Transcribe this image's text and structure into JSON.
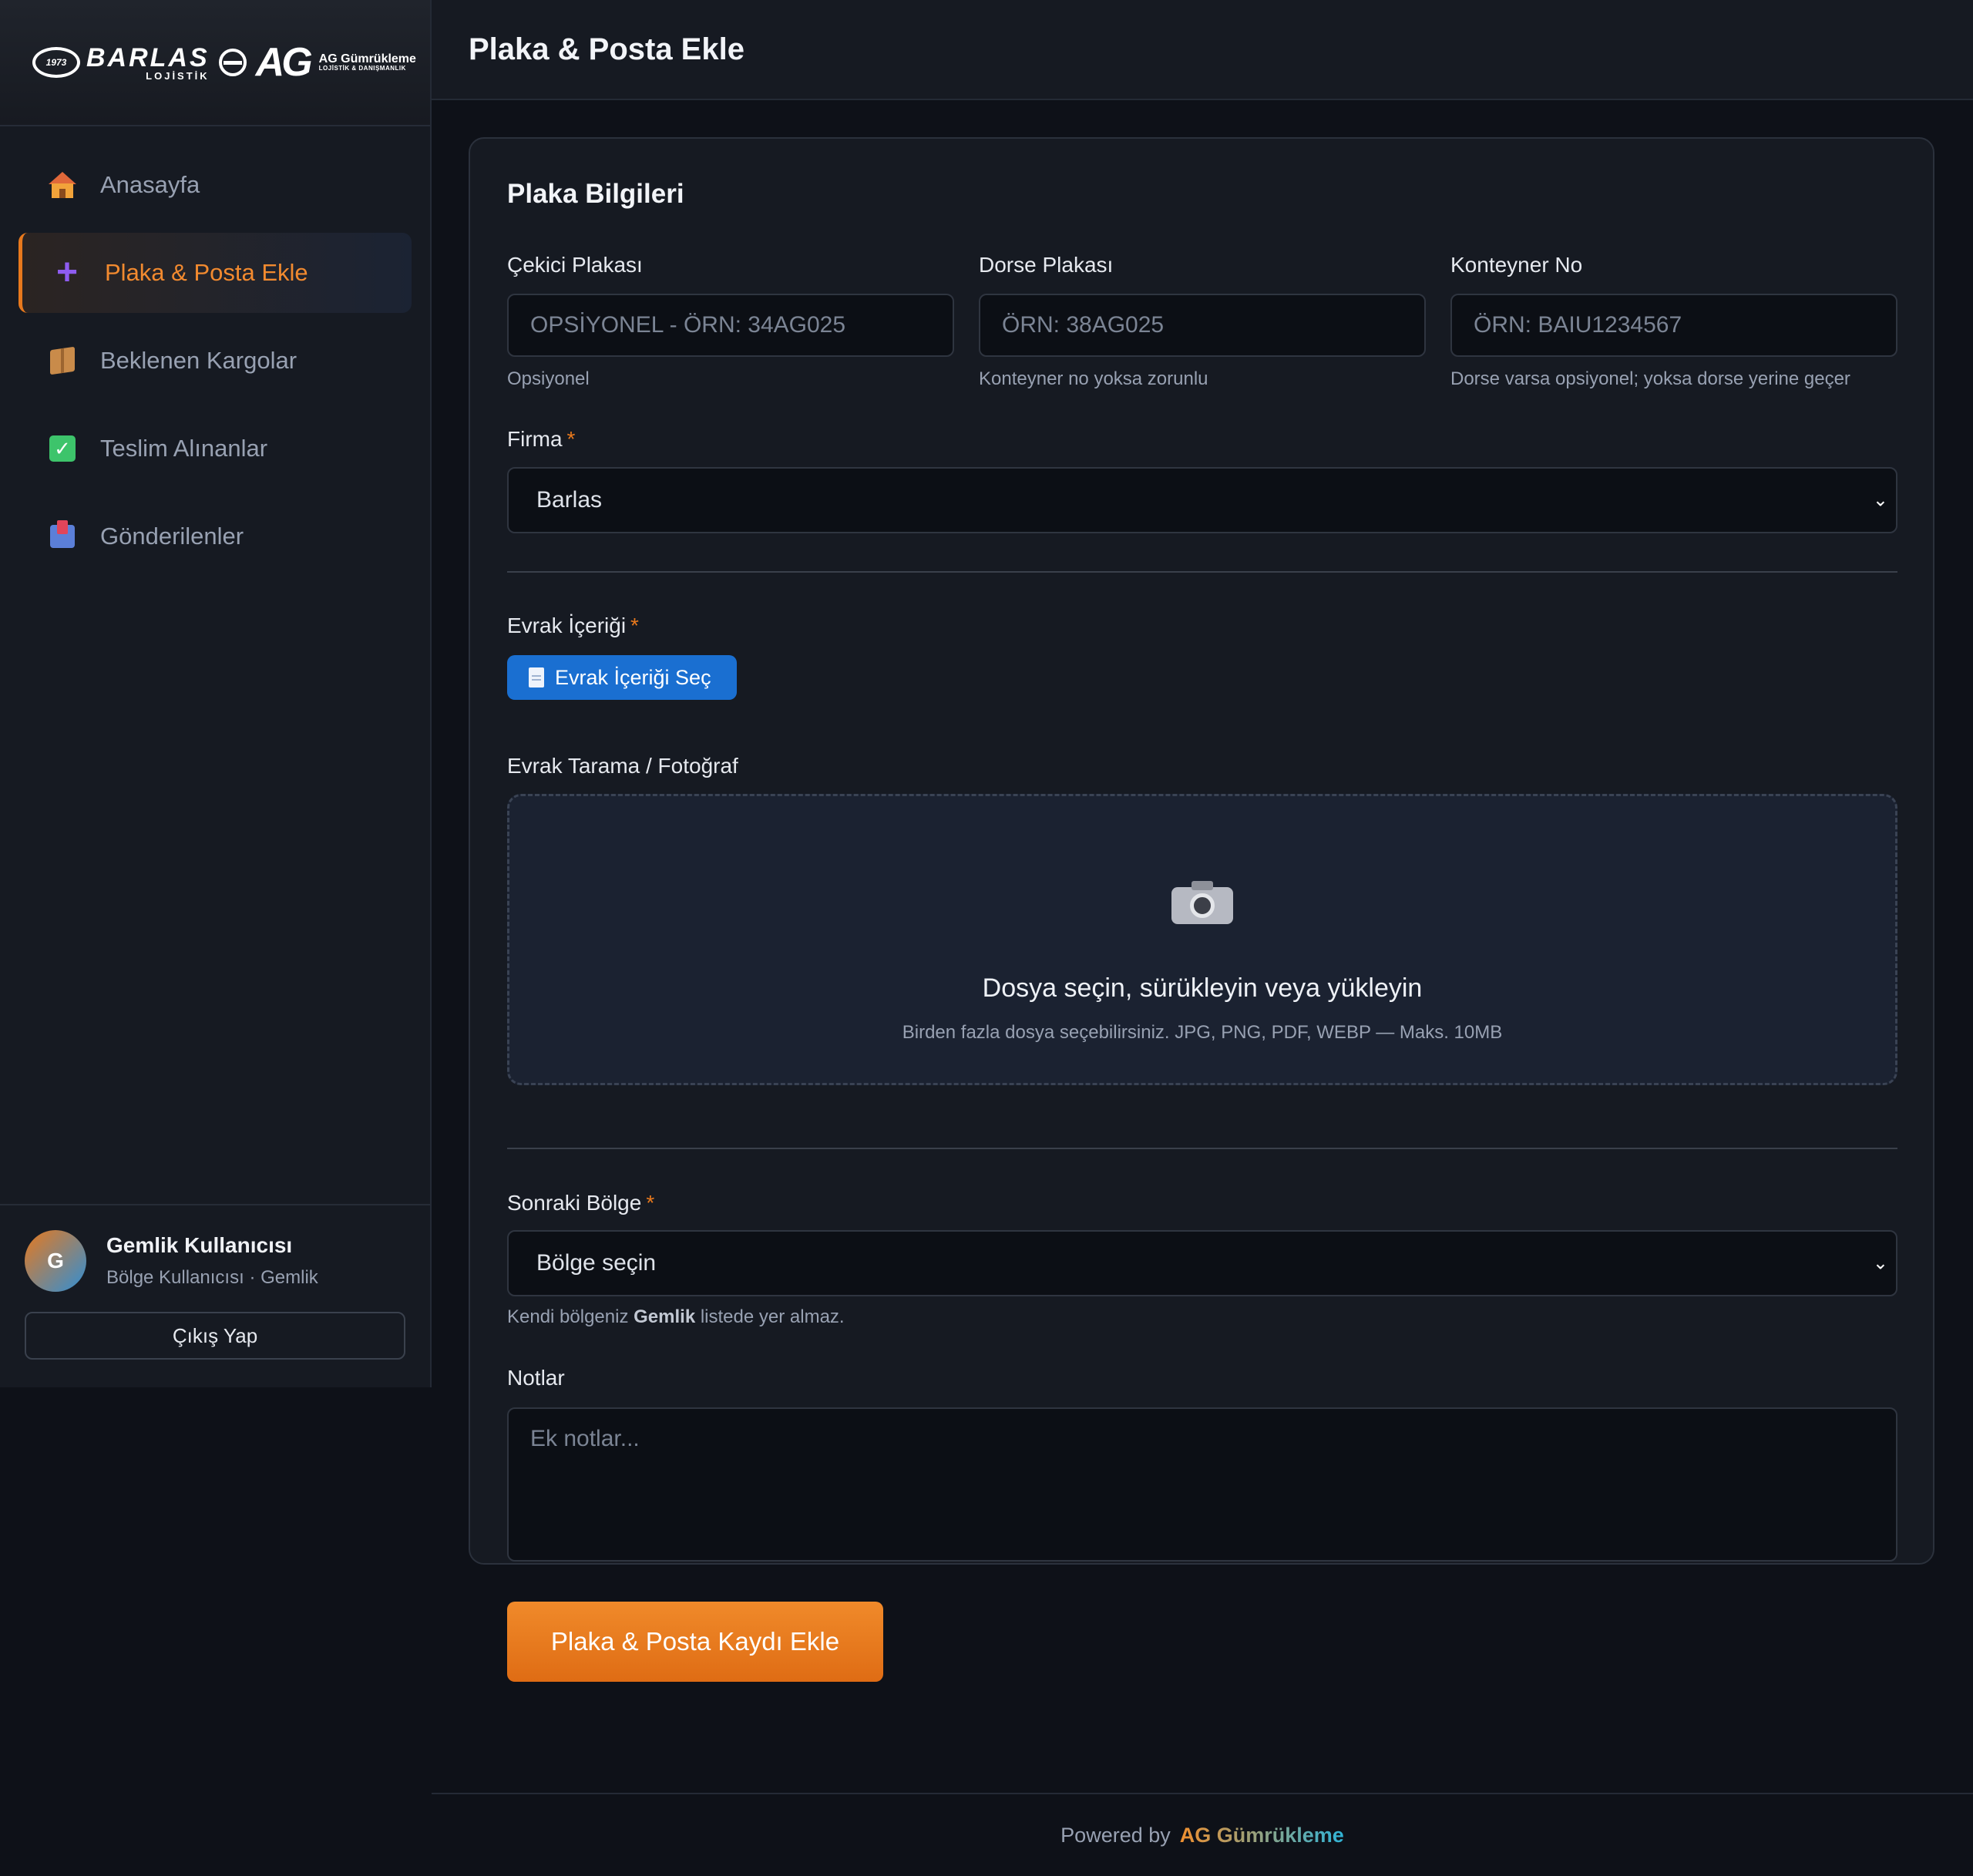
{
  "brand": {
    "barlas_year": "1973",
    "barlas_name": "BARLAS",
    "barlas_sub": "LOJİSTİK",
    "ag_mark": "AG",
    "ag_name": "AG Gümrükleme",
    "ag_sub": "LOJİSTİK & DANIŞMANLIK"
  },
  "sidebar": {
    "items": [
      {
        "label": "Anasayfa",
        "icon": "house-icon",
        "active": false
      },
      {
        "label": "Plaka & Posta Ekle",
        "icon": "plus-icon",
        "active": true
      },
      {
        "label": "Beklenen Kargolar",
        "icon": "package-icon",
        "active": false
      },
      {
        "label": "Teslim Alınanlar",
        "icon": "check-icon",
        "active": false
      },
      {
        "label": "Gönderilenler",
        "icon": "outbox-icon",
        "active": false
      }
    ],
    "user": {
      "initial": "G",
      "name": "Gemlik Kullanıcısı",
      "role": "Bölge Kullanıcısı · Gemlik",
      "logout_label": "Çıkış Yap"
    }
  },
  "header": {
    "title": "Plaka & Posta Ekle"
  },
  "form": {
    "section_title": "Plaka Bilgileri",
    "cekici": {
      "label": "Çekici Plakası",
      "placeholder": "OPSİYONEL - ÖRN: 34AG025",
      "hint": "Opsiyonel"
    },
    "dorse": {
      "label": "Dorse Plakası",
      "placeholder": "ÖRN: 38AG025",
      "hint": "Konteyner no yoksa zorunlu"
    },
    "konteyner": {
      "label": "Konteyner No",
      "placeholder": "ÖRN: BAIU1234567",
      "hint": "Dorse varsa opsiyonel; yoksa dorse yerine geçer"
    },
    "firma": {
      "label": "Firma",
      "required_mark": "*",
      "value": "Barlas"
    },
    "evrak": {
      "label": "Evrak İçeriği",
      "required_mark": "*",
      "button_label": "Evrak İçeriği Seç"
    },
    "upload": {
      "label": "Evrak Tarama / Fotoğraf",
      "title": "Dosya seçin, sürükleyin veya yükleyin",
      "subtitle": "Birden fazla dosya seçebilirsiniz. JPG, PNG, PDF, WEBP — Maks. 10MB"
    },
    "bolge": {
      "label": "Sonraki Bölge",
      "required_mark": "*",
      "value": "Bölge seçin",
      "hint_prefix": "Kendi bölgeniz",
      "hint_region": "Gemlik",
      "hint_suffix": "listede yer almaz."
    },
    "notlar": {
      "label": "Notlar",
      "placeholder": "Ek notlar..."
    },
    "submit_label": "Plaka & Posta Kaydı Ekle"
  },
  "footer": {
    "prefix": "Powered by",
    "brand": "AG Gümrükleme"
  },
  "colors": {
    "accent": "#e8791d",
    "primary_button": "#1a6fd1",
    "background": "#0e1118",
    "panel": "#161a22"
  }
}
